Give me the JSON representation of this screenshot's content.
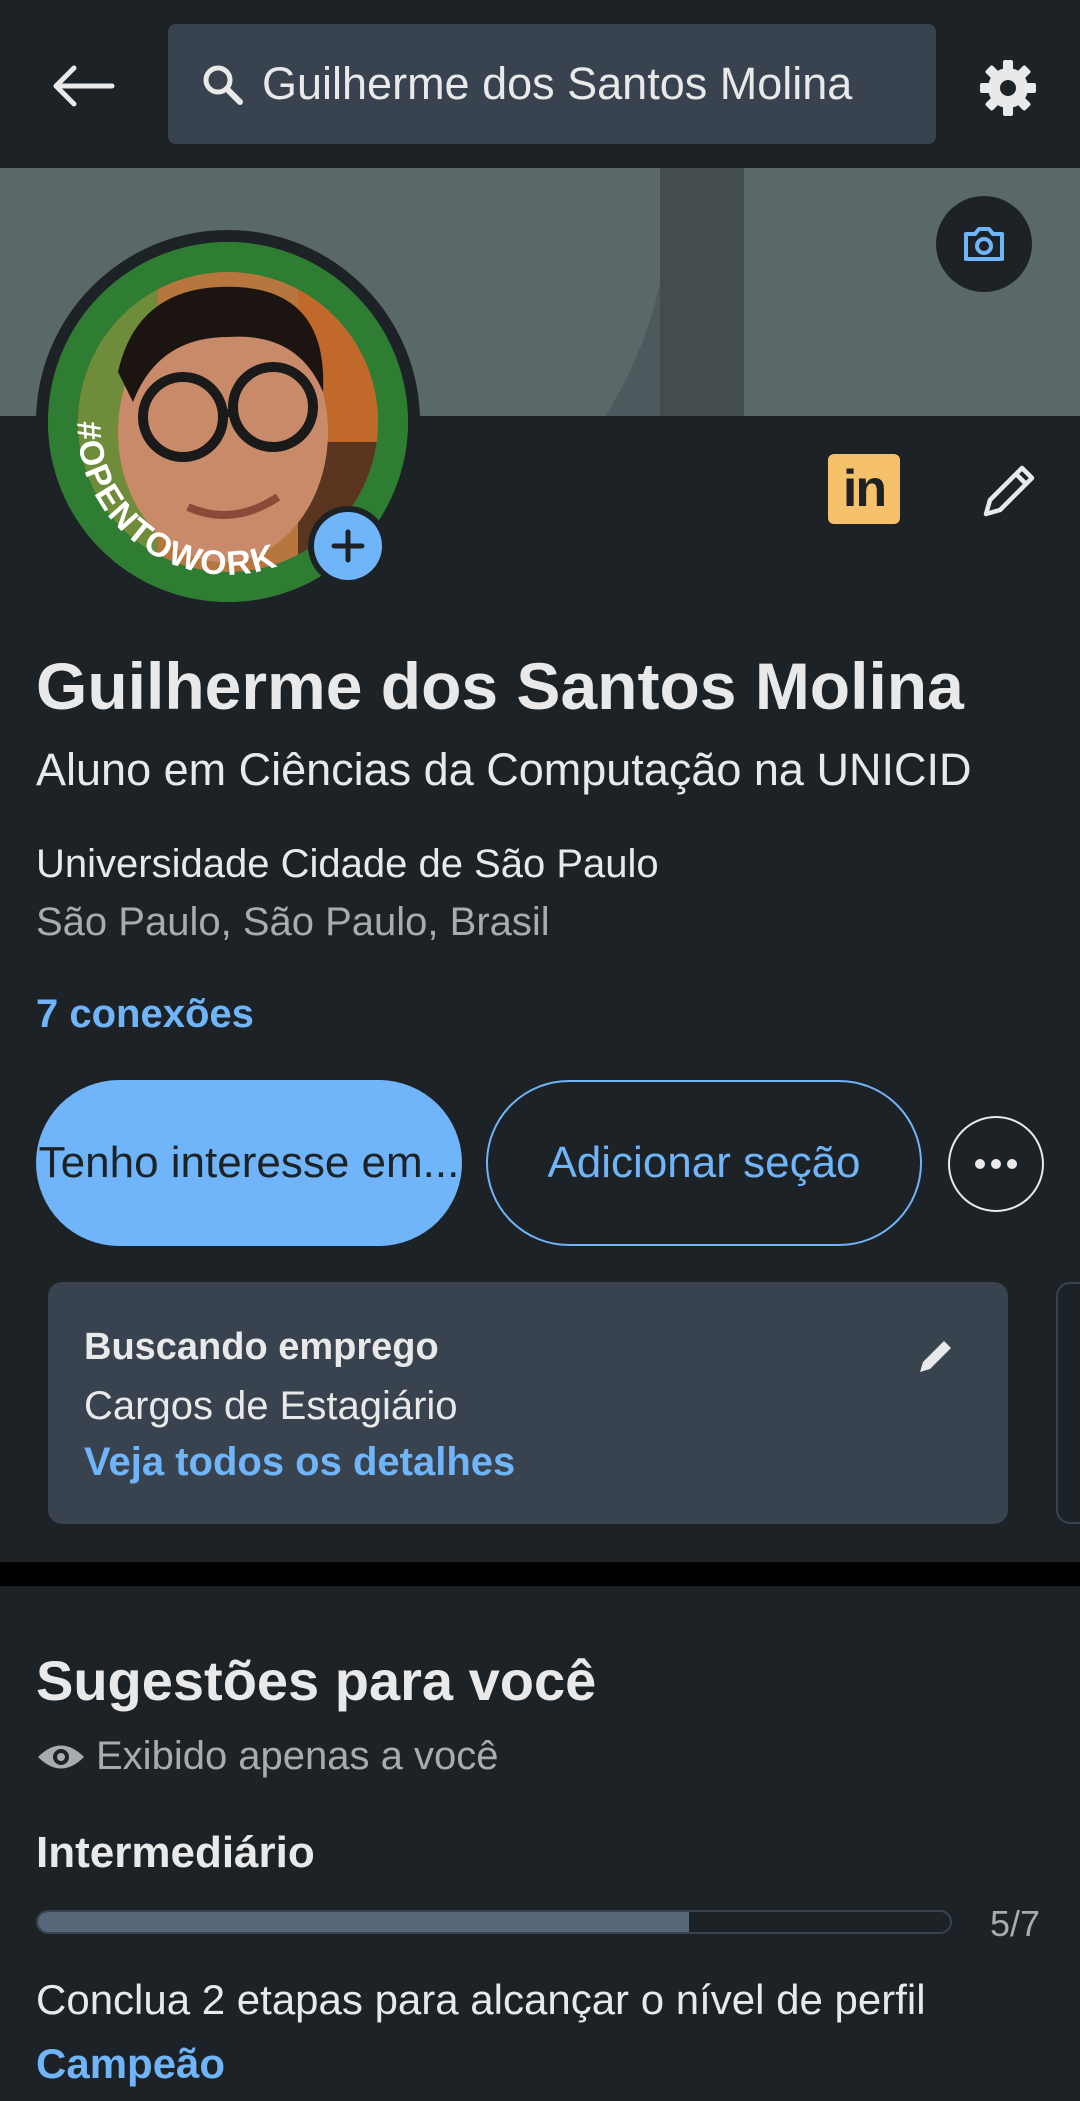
{
  "search": {
    "query": "Guilherme dos Santos Molina"
  },
  "profile": {
    "name": "Guilherme dos Santos Molina",
    "headline": "Aluno em Ciências da Computação na UNICID",
    "school": "Universidade Cidade de São Paulo",
    "location": "São Paulo, São Paulo, Brasil",
    "connections": "7 conexões",
    "badge": "#OPENTOWORK",
    "linkedin_logo": "in"
  },
  "actions": {
    "primary": "Tenho interesse em...",
    "secondary": "Adicionar seção"
  },
  "open_to_work": {
    "title": "Buscando emprego",
    "roles": "Cargos de Estagiário",
    "link": "Veja todos os detalhes"
  },
  "suggestions": {
    "title": "Sugestões para você",
    "visibility": "Exibido apenas a você",
    "level": "Intermediário",
    "progress": 0.714,
    "progress_label": "5/7",
    "steps_text": "Conclua 2 etapas para alcançar o nível de perfil",
    "target_level": "Campeão"
  },
  "colors": {
    "accent": "#70b5f9",
    "background": "#1d2226",
    "card": "#38434f",
    "badge_green": "#2e7d32"
  }
}
